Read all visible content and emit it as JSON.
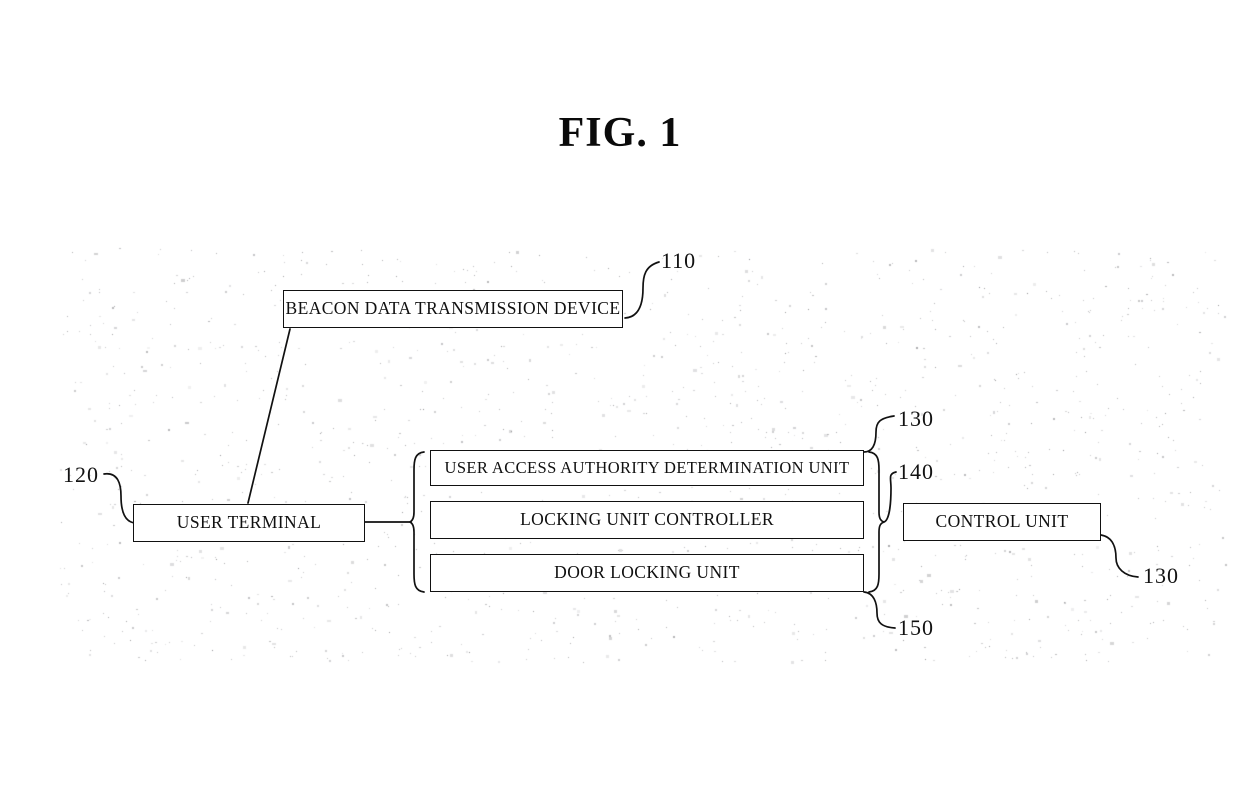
{
  "figure": {
    "title": "FIG. 1",
    "document_type": "patent-drawing"
  },
  "blocks": {
    "beacon": {
      "label": "BEACON DATA TRANSMISSION DEVICE",
      "ref": "110"
    },
    "user_terminal": {
      "label": "USER TERMINAL",
      "ref": "120"
    },
    "authority_unit": {
      "label": "USER ACCESS AUTHORITY DETERMINATION UNIT",
      "ref": "130"
    },
    "locking_controller": {
      "label": "LOCKING UNIT CONTROLLER",
      "ref": "140"
    },
    "door_locking_unit": {
      "label": "DOOR LOCKING UNIT",
      "ref": "150"
    },
    "control_unit": {
      "label": "CONTROL UNIT",
      "ref": "130"
    }
  },
  "reference_numerals": {
    "beacon_device": "110",
    "user_terminal": "120",
    "authority_unit": "130",
    "locking_controller": "140",
    "door_locking_unit": "150",
    "control_unit": "130"
  },
  "connectors": [
    {
      "name": "beacon-to-user-terminal",
      "kind": "straight-line",
      "from": "beacon",
      "to": "user_terminal"
    },
    {
      "name": "user-terminal-to-group",
      "kind": "line-with-left-brace",
      "from": "user_terminal",
      "to": "control-unit-group"
    },
    {
      "name": "group-right-brace",
      "kind": "right-brace",
      "from": "control-unit-group",
      "to": "control_unit"
    }
  ],
  "colors": {
    "ink": "#111111",
    "paper": "#ffffff",
    "speckle": "#b9b9bd"
  }
}
